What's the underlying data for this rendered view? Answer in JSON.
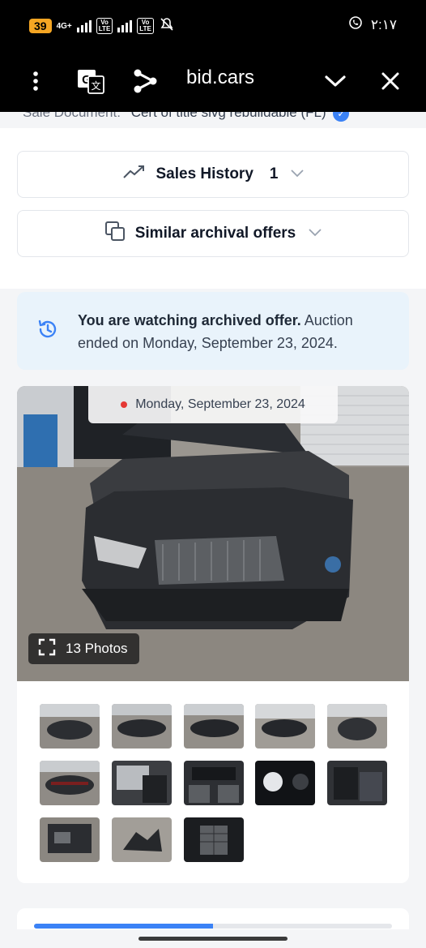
{
  "status_bar": {
    "battery": "39",
    "network": "4G+",
    "volte1": "Vo\nLTE",
    "volte2": "Vo\nLTE",
    "time": "٢:١٧",
    "icons": [
      "whatsapp-icon",
      "mute-icon"
    ]
  },
  "toolbar": {
    "menu_icon": "more-vertical-icon",
    "translate_icon": "translate-icon",
    "share_icon": "share-icon",
    "title": "bid.cars",
    "collapse_icon": "chevron-down-icon",
    "close_icon": "close-icon"
  },
  "details": {
    "sale_document_label": "Sale Document:",
    "sale_document_value": "Cert of title slvg rebuildable (FL)"
  },
  "sales_history": {
    "label": "Sales History",
    "count": "1"
  },
  "similar_offers": {
    "label": "Similar archival offers"
  },
  "notice": {
    "bold": "You are watching archived offer.",
    "rest": " Auction ended on Monday, September 23, 2024."
  },
  "gallery": {
    "date": "Monday, September 23, 2024",
    "photo_count": "13 Photos",
    "thumb_count": 13
  },
  "progress": {
    "fraction": 0.5
  },
  "colors": {
    "accent": "#3b82f6",
    "notice_bg": "#e9f3fb",
    "status_red": "#e53935",
    "battery": "#f5a623"
  }
}
